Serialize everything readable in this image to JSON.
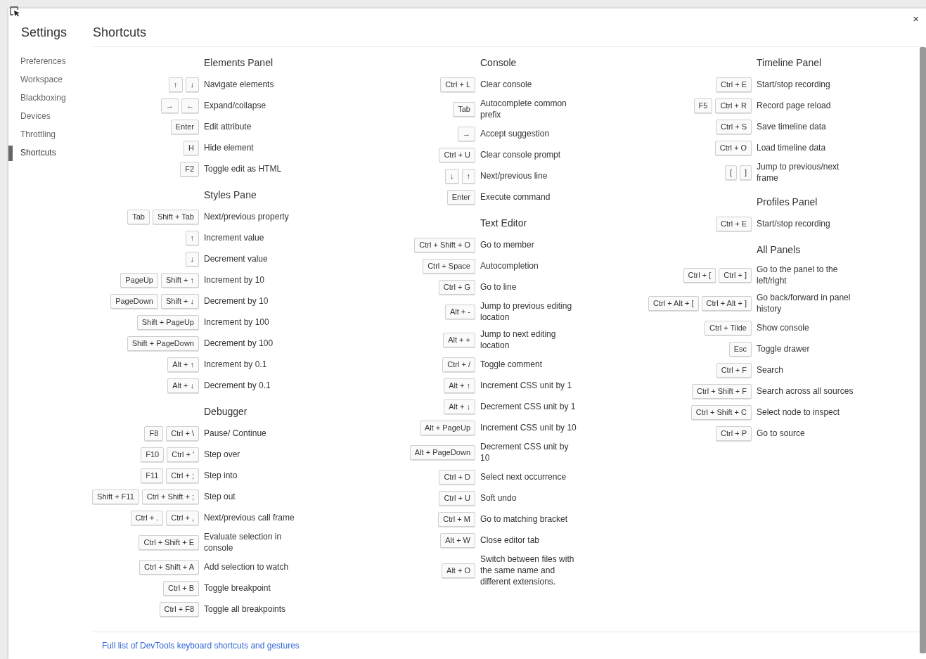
{
  "sidebar": {
    "title": "Settings",
    "items": [
      {
        "label": "Preferences",
        "selected": false
      },
      {
        "label": "Workspace",
        "selected": false
      },
      {
        "label": "Blackboxing",
        "selected": false
      },
      {
        "label": "Devices",
        "selected": false
      },
      {
        "label": "Throttling",
        "selected": false
      },
      {
        "label": "Shortcuts",
        "selected": true
      }
    ]
  },
  "title": "Shortcuts",
  "close": "×",
  "columns": [
    {
      "sections": [
        {
          "title": "Elements Panel",
          "shortcuts": [
            {
              "keys": [
                "↑",
                "↓"
              ],
              "description": "Navigate elements"
            },
            {
              "keys": [
                "→",
                "←"
              ],
              "description": "Expand/collapse"
            },
            {
              "keys": [
                "Enter"
              ],
              "description": "Edit attribute"
            },
            {
              "keys": [
                "H"
              ],
              "description": "Hide element"
            },
            {
              "keys": [
                "F2"
              ],
              "description": "Toggle edit as HTML"
            }
          ]
        },
        {
          "title": "Styles Pane",
          "shortcuts": [
            {
              "keys": [
                "Tab",
                "Shift + Tab"
              ],
              "description": "Next/previous property"
            },
            {
              "keys": [
                "↑"
              ],
              "description": "Increment value"
            },
            {
              "keys": [
                "↓"
              ],
              "description": "Decrement value"
            },
            {
              "keys": [
                "PageUp",
                "Shift + ↑"
              ],
              "description": "Increment by 10"
            },
            {
              "keys": [
                "PageDown",
                "Shift + ↓"
              ],
              "description": "Decrement by 10"
            },
            {
              "keys": [
                "Shift + PageUp"
              ],
              "description": "Increment by 100"
            },
            {
              "keys": [
                "Shift + PageDown"
              ],
              "description": "Decrement by 100"
            },
            {
              "keys": [
                "Alt + ↑"
              ],
              "description": "Increment by 0.1"
            },
            {
              "keys": [
                "Alt + ↓"
              ],
              "description": "Decrement by 0.1"
            }
          ]
        },
        {
          "title": "Debugger",
          "shortcuts": [
            {
              "keys": [
                "F8",
                "Ctrl + \\"
              ],
              "description": "Pause/ Continue"
            },
            {
              "keys": [
                "F10",
                "Ctrl + '"
              ],
              "description": "Step over"
            },
            {
              "keys": [
                "F11",
                "Ctrl + ;"
              ],
              "description": "Step into"
            },
            {
              "keys": [
                "Shift + F11",
                "Ctrl + Shift + ;"
              ],
              "description": "Step out"
            },
            {
              "keys": [
                "Ctrl + .",
                "Ctrl + ,"
              ],
              "description": "Next/previous call frame"
            },
            {
              "keys": [
                "Ctrl + Shift + E"
              ],
              "description": "Evaluate selection in console"
            },
            {
              "keys": [
                "Ctrl + Shift + A"
              ],
              "description": "Add selection to watch"
            },
            {
              "keys": [
                "Ctrl + B"
              ],
              "description": "Toggle breakpoint"
            },
            {
              "keys": [
                "Ctrl + F8"
              ],
              "description": "Toggle all breakpoints"
            }
          ]
        }
      ]
    },
    {
      "sections": [
        {
          "title": "Console",
          "shortcuts": [
            {
              "keys": [
                "Ctrl + L"
              ],
              "description": "Clear console"
            },
            {
              "keys": [
                "Tab"
              ],
              "description": "Autocomplete common prefix"
            },
            {
              "keys": [
                "→"
              ],
              "description": "Accept suggestion"
            },
            {
              "keys": [
                "Ctrl + U"
              ],
              "description": "Clear console prompt"
            },
            {
              "keys": [
                "↓",
                "↑"
              ],
              "description": "Next/previous line"
            },
            {
              "keys": [
                "Enter"
              ],
              "description": "Execute command"
            }
          ]
        },
        {
          "title": "Text Editor",
          "shortcuts": [
            {
              "keys": [
                "Ctrl + Shift + O"
              ],
              "description": "Go to member"
            },
            {
              "keys": [
                "Ctrl + Space"
              ],
              "description": "Autocompletion"
            },
            {
              "keys": [
                "Ctrl + G"
              ],
              "description": "Go to line"
            },
            {
              "keys": [
                "Alt + -"
              ],
              "description": "Jump to previous editing location"
            },
            {
              "keys": [
                "Alt + +"
              ],
              "description": "Jump to next editing location"
            },
            {
              "keys": [
                "Ctrl + /"
              ],
              "description": "Toggle comment"
            },
            {
              "keys": [
                "Alt + ↑"
              ],
              "description": "Increment CSS unit by 1"
            },
            {
              "keys": [
                "Alt + ↓"
              ],
              "description": "Decrement CSS unit by 1"
            },
            {
              "keys": [
                "Alt + PageUp"
              ],
              "description": "Increment CSS unit by 10"
            },
            {
              "keys": [
                "Alt + PageDown"
              ],
              "description": "Decrement CSS unit by 10"
            },
            {
              "keys": [
                "Ctrl + D"
              ],
              "description": "Select next occurrence"
            },
            {
              "keys": [
                "Ctrl + U"
              ],
              "description": "Soft undo"
            },
            {
              "keys": [
                "Ctrl + M"
              ],
              "description": "Go to matching bracket"
            },
            {
              "keys": [
                "Alt + W"
              ],
              "description": "Close editor tab"
            },
            {
              "keys": [
                "Alt + O"
              ],
              "description": "Switch between files with the same name and different extensions."
            }
          ]
        }
      ]
    },
    {
      "sections": [
        {
          "title": "Timeline Panel",
          "shortcuts": [
            {
              "keys": [
                "Ctrl + E"
              ],
              "description": "Start/stop recording"
            },
            {
              "keys": [
                "F5",
                "Ctrl + R"
              ],
              "description": "Record page reload"
            },
            {
              "keys": [
                "Ctrl + S"
              ],
              "description": "Save timeline data"
            },
            {
              "keys": [
                "Ctrl + O"
              ],
              "description": "Load timeline data"
            },
            {
              "keys": [
                "[",
                "]"
              ],
              "description": "Jump to previous/next frame"
            }
          ]
        },
        {
          "title": "Profiles Panel",
          "shortcuts": [
            {
              "keys": [
                "Ctrl + E"
              ],
              "description": "Start/stop recording"
            }
          ]
        },
        {
          "title": "All Panels",
          "shortcuts": [
            {
              "keys": [
                "Ctrl + [",
                "Ctrl + ]"
              ],
              "description": "Go to the panel to the left/right"
            },
            {
              "keys": [
                "Ctrl + Alt + [",
                "Ctrl + Alt + ]"
              ],
              "description": "Go back/forward in panel history"
            },
            {
              "keys": [
                "Ctrl + Tilde"
              ],
              "description": "Show console"
            },
            {
              "keys": [
                "Esc"
              ],
              "description": "Toggle drawer"
            },
            {
              "keys": [
                "Ctrl + F"
              ],
              "description": "Search"
            },
            {
              "keys": [
                "Ctrl + Shift + F"
              ],
              "description": "Search across all sources"
            },
            {
              "keys": [
                "Ctrl + Shift + C"
              ],
              "description": "Select node to inspect"
            },
            {
              "keys": [
                "Ctrl + P"
              ],
              "description": "Go to source"
            }
          ]
        }
      ]
    }
  ],
  "footer_link": "Full list of DevTools keyboard shortcuts and gestures"
}
